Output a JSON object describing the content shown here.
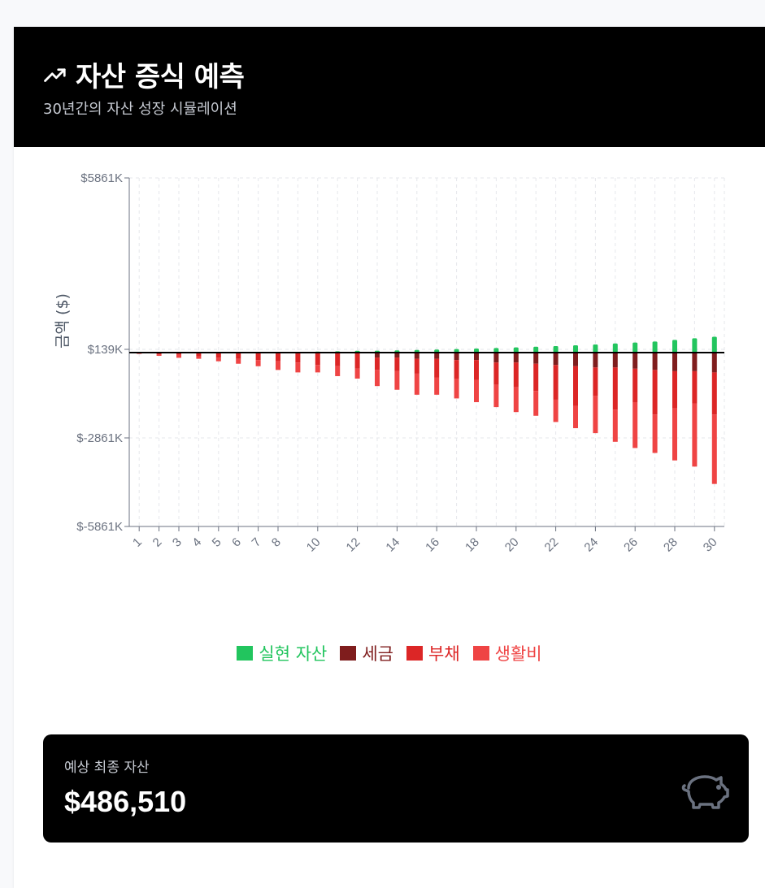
{
  "header": {
    "title": "자산 증식 예측",
    "subtitle": "30년간의 자산 성장 시뮬레이션",
    "icon": "trending-up-icon"
  },
  "summary": {
    "label": "예상 최종 자산",
    "value": "$486,510",
    "icon": "piggy-bank-icon"
  },
  "legend": [
    {
      "name": "실현 자산",
      "color": "#22c55e"
    },
    {
      "name": "세금",
      "color": "#7f1d1d"
    },
    {
      "name": "부채",
      "color": "#dc2626"
    },
    {
      "name": "생활비",
      "color": "#ef4444"
    }
  ],
  "chart_data": {
    "type": "bar",
    "stacked": true,
    "ylabel": "금액 ($)",
    "xlabel": "",
    "ylim": [
      -5861,
      5861
    ],
    "y_ticks": [
      5861,
      139,
      -2861,
      -5861
    ],
    "y_tick_labels": [
      "$5861K",
      "$139K",
      "$-2861K",
      "$-5861K"
    ],
    "grid": true,
    "categories": [
      "1",
      "2",
      "3",
      "4",
      "5",
      "6",
      "7",
      "8",
      "9",
      "10",
      "11",
      "12",
      "13",
      "14",
      "15",
      "16",
      "17",
      "18",
      "19",
      "20",
      "21",
      "22",
      "23",
      "24",
      "25",
      "26",
      "27",
      "28",
      "29",
      "30"
    ],
    "x_tick_labels": [
      "1",
      "2",
      "3",
      "4",
      "5",
      "6",
      "7",
      "8",
      "10",
      "12",
      "14",
      "16",
      "18",
      "20",
      "22",
      "24",
      "26",
      "28",
      "30"
    ],
    "series": [
      {
        "name": "실현 자산",
        "color": "#22c55e",
        "values": [
          0,
          0,
          0,
          0,
          0,
          0,
          0,
          10,
          20,
          30,
          40,
          55,
          60,
          70,
          80,
          95,
          110,
          125,
          140,
          160,
          180,
          200,
          225,
          250,
          280,
          310,
          340,
          390,
          440,
          486
        ]
      },
      {
        "name": "세금",
        "color": "#7f1d1d",
        "values": [
          0,
          0,
          0,
          0,
          0,
          0,
          0,
          0,
          0,
          0,
          0,
          0,
          -200,
          -200,
          -250,
          -250,
          -300,
          -300,
          -400,
          -400,
          -450,
          -500,
          -550,
          -600,
          -600,
          -650,
          -700,
          -750,
          -750,
          -800
        ]
      },
      {
        "name": "부채",
        "color": "#dc2626",
        "values": [
          -50,
          -70,
          -90,
          -150,
          -200,
          -250,
          -300,
          -350,
          -400,
          -500,
          -550,
          -650,
          -500,
          -550,
          -600,
          -750,
          -750,
          -800,
          -900,
          -1000,
          -1100,
          -1400,
          -1600,
          -1150,
          -1700,
          -1350,
          -1800,
          -1500,
          -1300,
          -1700
        ]
      },
      {
        "name": "생활비",
        "color": "#ef4444",
        "values": [
          0,
          -60,
          -120,
          -100,
          -150,
          -200,
          -250,
          -350,
          -400,
          -300,
          -400,
          -400,
          -650,
          -750,
          -850,
          -700,
          -800,
          -900,
          -900,
          -1000,
          -1000,
          -900,
          -900,
          -1500,
          -1300,
          -1850,
          -1550,
          -2100,
          -2550,
          -2800
        ]
      }
    ]
  }
}
